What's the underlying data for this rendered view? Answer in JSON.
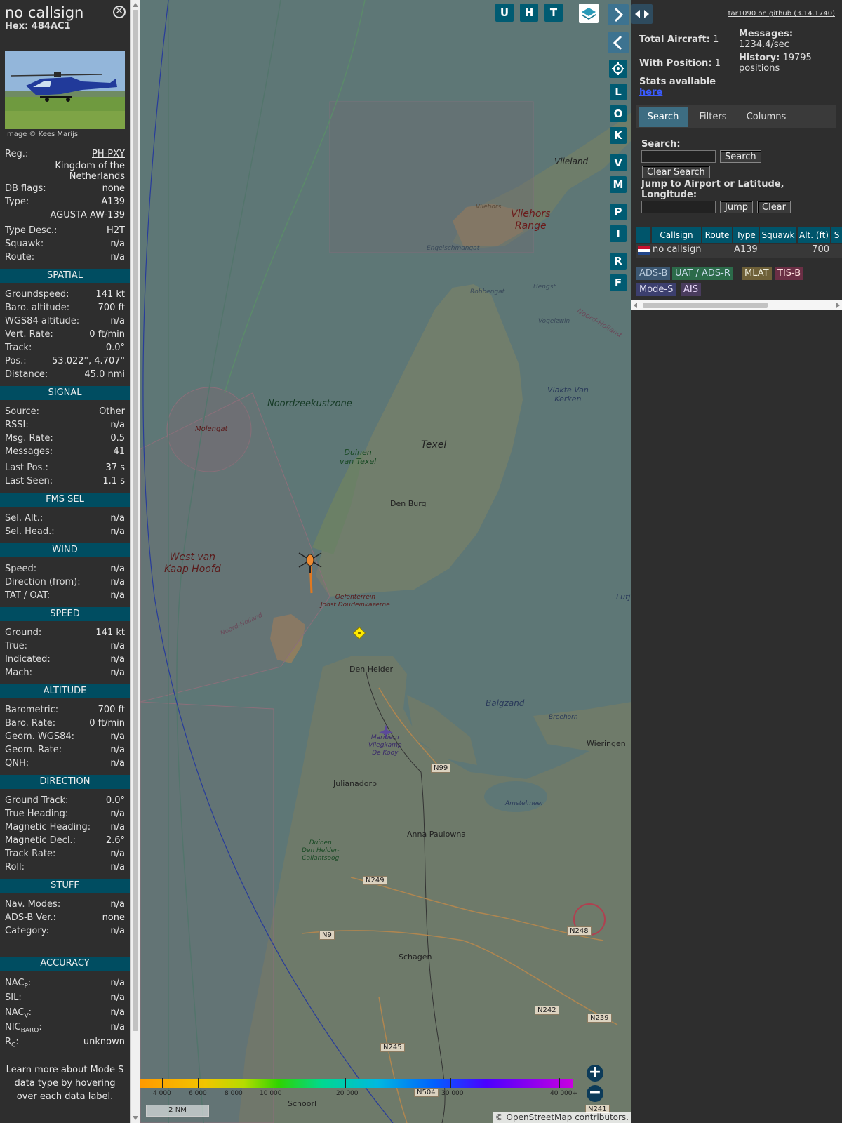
{
  "sidebar": {
    "callsign": "no callsign",
    "hex_label": "Hex:",
    "hex": "484AC1",
    "photo_credit": "Image © Kees Marijs",
    "reg_label": "Reg.:",
    "reg": "PH-PXY",
    "country": "Kingdom of the Netherlands",
    "db_flags_label": "DB flags:",
    "db_flags": "none",
    "type_label": "Type:",
    "type": "A139",
    "type_full": "AGUSTA AW-139",
    "type_desc_label": "Type Desc.:",
    "type_desc": "H2T",
    "squawk_label": "Squawk:",
    "squawk": "n/a",
    "route_label": "Route:",
    "route": "n/a",
    "sections": {
      "spatial": "SPATIAL",
      "signal": "SIGNAL",
      "fms": "FMS SEL",
      "wind": "WIND",
      "speed": "SPEED",
      "altitude": "ALTITUDE",
      "direction": "DIRECTION",
      "stuff": "STUFF",
      "accuracy": "ACCURACY"
    },
    "spatial": [
      {
        "label": "Groundspeed:",
        "value": "141 kt"
      },
      {
        "label": "Baro. altitude:",
        "value": "700 ft"
      },
      {
        "label": "WGS84 altitude:",
        "value": "n/a"
      },
      {
        "label": "Vert. Rate:",
        "value": "0 ft/min"
      },
      {
        "label": "Track:",
        "value": "0.0°"
      },
      {
        "label": "Pos.:",
        "value": "53.022°, 4.707°"
      },
      {
        "label": "Distance:",
        "value": "45.0 nmi"
      }
    ],
    "signal": [
      {
        "label": "Source:",
        "value": "Other"
      },
      {
        "label": "RSSI:",
        "value": "n/a"
      },
      {
        "label": "Msg. Rate:",
        "value": "0.5"
      },
      {
        "label": "Messages:",
        "value": "41"
      },
      {
        "label": "Last Pos.:",
        "value": "37 s"
      },
      {
        "label": "Last Seen:",
        "value": "1.1 s"
      }
    ],
    "fms": [
      {
        "label": "Sel. Alt.:",
        "value": "n/a"
      },
      {
        "label": "Sel. Head.:",
        "value": "n/a"
      }
    ],
    "wind": [
      {
        "label": "Speed:",
        "value": "n/a"
      },
      {
        "label": "Direction (from):",
        "value": "n/a"
      },
      {
        "label": "TAT / OAT:",
        "value": "n/a"
      }
    ],
    "speed": [
      {
        "label": "Ground:",
        "value": "141 kt"
      },
      {
        "label": "True:",
        "value": "n/a"
      },
      {
        "label": "Indicated:",
        "value": "n/a"
      },
      {
        "label": "Mach:",
        "value": "n/a"
      }
    ],
    "altitude": [
      {
        "label": "Barometric:",
        "value": "700 ft"
      },
      {
        "label": "Baro. Rate:",
        "value": "0 ft/min"
      },
      {
        "label": "Geom. WGS84:",
        "value": "n/a"
      },
      {
        "label": "Geom. Rate:",
        "value": "n/a"
      },
      {
        "label": "QNH:",
        "value": "n/a"
      }
    ],
    "direction": [
      {
        "label": "Ground Track:",
        "value": "0.0°"
      },
      {
        "label": "True Heading:",
        "value": "n/a"
      },
      {
        "label": "Magnetic Heading:",
        "value": "n/a"
      },
      {
        "label": "Magnetic Decl.:",
        "value": "2.6°"
      },
      {
        "label": "Track Rate:",
        "value": "n/a"
      },
      {
        "label": "Roll:",
        "value": "n/a"
      }
    ],
    "stuff": [
      {
        "label": "Nav. Modes:",
        "value": "n/a"
      },
      {
        "label": "ADS-B Ver.:",
        "value": "none"
      },
      {
        "label": "Category:",
        "value": "n/a"
      }
    ],
    "accuracy": [
      {
        "label": "NAC",
        "sub": "P",
        "value": "n/a"
      },
      {
        "label": "SIL:",
        "sub": "",
        "value": "n/a"
      },
      {
        "label": "NAC",
        "sub": "V",
        "value": "n/a"
      },
      {
        "label": "NIC",
        "sub": "BARO",
        "value": "n/a"
      },
      {
        "label": "R",
        "sub": "C",
        "value": "unknown"
      }
    ],
    "learn_more": "Learn more about Mode S data type by hovering over each data label."
  },
  "map": {
    "toolbar": [
      "U",
      "H",
      "T"
    ],
    "side_buttons": [
      "L",
      "O",
      "K",
      "V",
      "M",
      "P",
      "I",
      "R",
      "F"
    ],
    "labels": {
      "vlieland": "Vlieland",
      "vliehors": "Vliehors",
      "vliehors_range_1": "Vliehors",
      "vliehors_range_2": "Range",
      "engelschmangat": "Engelschmangat",
      "robbengat": "Robbengat",
      "hengst": "Hengst",
      "vogelzwin": "Vogelzwin",
      "noord_holland_ne": "Noord-Holland",
      "noordzeekustzone": "Noordzeekustzone",
      "vlakte_1": "Vlakte Van",
      "vlakte_2": "Kerken",
      "molengat": "Molengat",
      "texel": "Texel",
      "duinen_texel_1": "Duinen",
      "duinen_texel_2": "van Texel",
      "den_burg": "Den Burg",
      "west_van_1": "West van",
      "west_van_2": "Kaap Hoofd",
      "oefenterrein_1": "Oefenterrein",
      "oefenterrein_2": "Joost Dourleinkazerne",
      "noord_holland_w": "Noord-Holland",
      "lutj": "Lutj",
      "den_helder": "Den Helder",
      "balgzand": "Balgzand",
      "breehorn": "Breehorn",
      "wieringen": "Wieringen",
      "maritiem_1": "Maritiem",
      "maritiem_2": "Vliegkamp",
      "maritiem_3": "De Kooy",
      "n99": "N99",
      "julianadorp": "Julianadorp",
      "amstelmeer": "Amstelmeer",
      "anna_paulowna": "Anna Paulowna",
      "duinen_dh_1": "Duinen",
      "duinen_dh_2": "Den Helder-",
      "duinen_dh_3": "Callantsoog",
      "n249": "N249",
      "n248": "N248",
      "n9": "N9",
      "schagen": "Schagen",
      "n242": "N242",
      "n239": "N239",
      "n245": "N245",
      "n504": "N504",
      "schoorl": "Schoorl",
      "n241": "N241"
    },
    "altitude_scale": [
      "4 000",
      "6 000",
      "8 000",
      "10 000",
      "20 000",
      "30 000",
      "40 000+"
    ],
    "scale_bar": "2 NM",
    "attribution_prefix": "© ",
    "attribution_link": "OpenStreetMap",
    "attribution_suffix": " contributors.",
    "zoom_in": "+",
    "zoom_out": "−"
  },
  "panel": {
    "github_link": "tar1090 on github (3.14.1740)",
    "total_aircraft_label": "Total Aircraft:",
    "total_aircraft": "1",
    "with_position_label": "With Position:",
    "with_position": "1",
    "messages_label": "Messages:",
    "messages": "1234.4/sec",
    "history_label": "History:",
    "history_1": "19795",
    "history_2": "positions",
    "stats_label": "Stats available",
    "stats_link": "here",
    "tabs": [
      "Search",
      "Filters",
      "Columns"
    ],
    "search_label": "Search:",
    "search_button": "Search",
    "clear_search_button": "Clear Search",
    "jump_label_1": "Jump to Airport or Latitude,",
    "jump_label_2": "Longitude:",
    "jump_button": "Jump",
    "clear_button": "Clear",
    "table_headers": [
      "Callsign",
      "Route",
      "Type",
      "Squawk",
      "Alt. (ft)",
      "S"
    ],
    "table_row": {
      "callsign": "no callsign",
      "route": "",
      "type": "A139",
      "squawk": "",
      "alt": "700"
    },
    "legend": [
      "ADS-B",
      "UAT / ADS-R",
      "MLAT",
      "TIS-B",
      "Mode-S",
      "AIS"
    ],
    "colors": {
      "adsb": "#3c5873",
      "uat": "#2c6b4a",
      "mlat": "#6e6038",
      "tisb": "#6b2f45",
      "modes": "#3c3f6e",
      "ais": "#4a3c5e"
    }
  }
}
